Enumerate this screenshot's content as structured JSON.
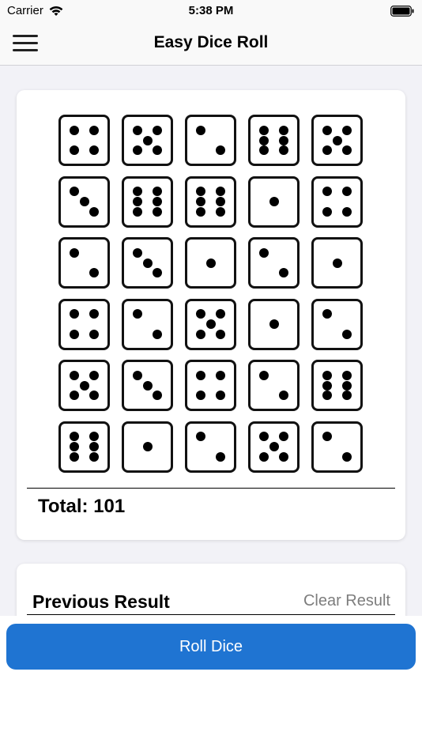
{
  "status_bar": {
    "carrier": "Carrier",
    "time": "5:38 PM",
    "wifi_icon": "wifi-icon",
    "battery_icon": "battery-icon"
  },
  "nav": {
    "menu_icon": "hamburger-menu-icon",
    "title": "Easy Dice Roll"
  },
  "dice": [
    4,
    5,
    2,
    6,
    5,
    3,
    6,
    6,
    1,
    4,
    2,
    3,
    1,
    2,
    1,
    4,
    2,
    5,
    1,
    2,
    5,
    3,
    4,
    2,
    6,
    6,
    1,
    2,
    5,
    2
  ],
  "total_label": "Total: 101",
  "history": {
    "label": "Previous Result",
    "clear_label": "Clear Result"
  },
  "roll_button_label": "Roll Dice",
  "colors": {
    "accent": "#1f74d2",
    "background": "#f2f2f7",
    "muted_text": "#7d7d7d"
  }
}
